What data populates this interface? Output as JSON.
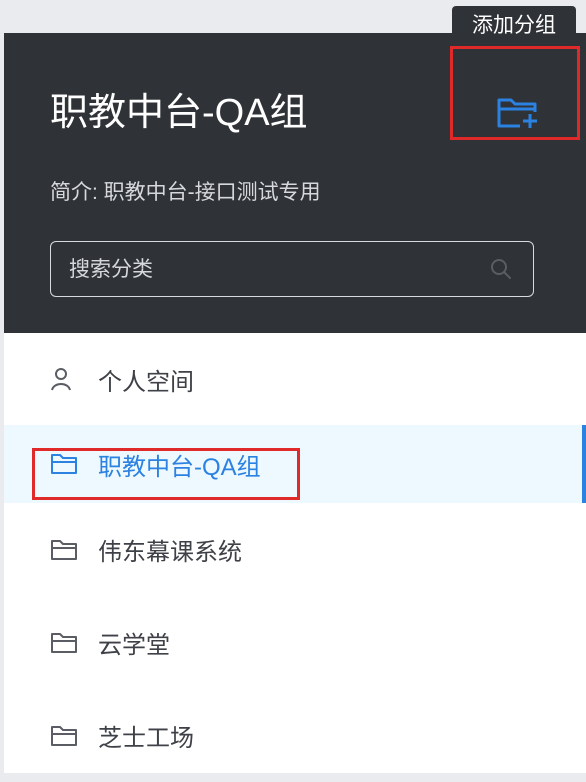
{
  "header": {
    "title": "职教中台-QA组",
    "description": "简介: 职教中台-接口测试专用",
    "add_group_icon": "folder-add-icon",
    "tooltip": "添加分组"
  },
  "search": {
    "placeholder": "搜索分类",
    "icon": "search-icon"
  },
  "menu": {
    "items": [
      {
        "label": "个人空间",
        "icon": "user-icon",
        "active": false
      },
      {
        "label": "职教中台-QA组",
        "icon": "folder-icon",
        "active": true
      },
      {
        "label": "伟东幕课系统",
        "icon": "folder-icon",
        "active": false
      },
      {
        "label": "云学堂",
        "icon": "folder-icon",
        "active": false
      },
      {
        "label": "芝士工场",
        "icon": "folder-icon",
        "active": false
      }
    ]
  },
  "colors": {
    "header_bg": "#2f3237",
    "accent": "#2b82e0",
    "active_bg": "#eef8ff",
    "highlight_red": "#e02a2a"
  }
}
